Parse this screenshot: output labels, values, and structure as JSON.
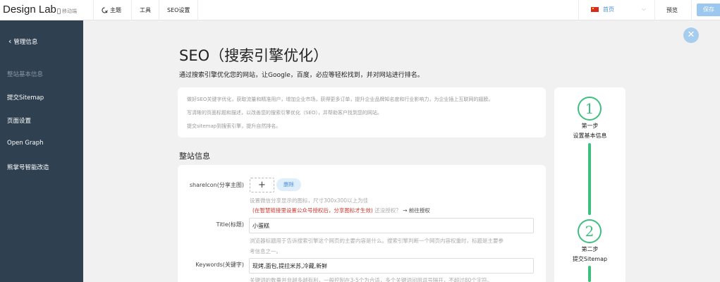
{
  "header": {
    "brand": "Design Lab",
    "mobile_label": "移动端",
    "nav": [
      {
        "label": "主题",
        "icon": "theme-icon"
      },
      {
        "label": "工具"
      },
      {
        "label": "SEO设置"
      }
    ],
    "language": {
      "label": "首页",
      "icon": "china-flag-icon"
    },
    "preview_label": "预览",
    "save_label": "保存"
  },
  "sidebar": {
    "back_label": "管理信息",
    "items": [
      {
        "label": "整站基本信息",
        "active": true
      },
      {
        "label": "提交Sitemap"
      },
      {
        "label": "页面设置"
      },
      {
        "label": "Open Graph"
      },
      {
        "label": "熊掌号智能改造"
      }
    ]
  },
  "main": {
    "title": "SEO（搜索引擎优化）",
    "subtitle": "通过搜索引擎优化您的网站，让Google，百度，必应等轻松找到，并对网站进行排名。",
    "intro_lines": [
      "做好SEO关键字优化，获取流量和精准用户，增加企业市场，获得更多订单，提升企业品牌知名度和行业影响力，为企业插上互联网的翅膀。",
      "写清晰的页面标题和描述，以改善您的搜索引擎优化（SEO），并帮助客户找到您的网站。",
      "提交sitemap到搜索引擎，提升自然排名。"
    ],
    "section_title": "整站信息",
    "form": {
      "share_icon_label": "shareIcon(分享主图)",
      "upload_plus": "+",
      "delete_label": "删除",
      "share_hint": "设置微信分享显示的图标，尺寸300x300以上为佳",
      "share_red_note": "(在智慧链接里设置公众号授权后，分享图标才生效)",
      "share_auth_text": "还没授权？",
      "share_auth_link": "→ 前往授权",
      "title_label": "Title(标题)",
      "title_value": "小蛋糕",
      "title_hint_1": "浏览器标题用于告诉搜索引擎这个网页的主要内容是什么。搜索引擎判断一个网页内容权重时，标题是主要参",
      "title_hint_2": "考信息之一。",
      "keywords_label": "Keywords(关键字)",
      "keywords_value": "现烤,面包,提拉米苏,冷藏,新鲜",
      "keywords_hint": "关键词的数量并非越多越有利，一般控制在3-5个为合适，多个关键词间用逗号隔开，不超过80个字符。"
    }
  },
  "steps": [
    {
      "number": "1",
      "title": "第一步",
      "subtitle": "设置基本信息"
    },
    {
      "number": "2",
      "title": "第二步",
      "subtitle": "提交Sitemap"
    }
  ],
  "colors": {
    "sidebar_bg": "#2f4050",
    "accent_green": "#3fbf7f",
    "accent_blue": "#4a90d9",
    "save_button": "#9cc7ef",
    "warning_red": "#d0342c"
  }
}
